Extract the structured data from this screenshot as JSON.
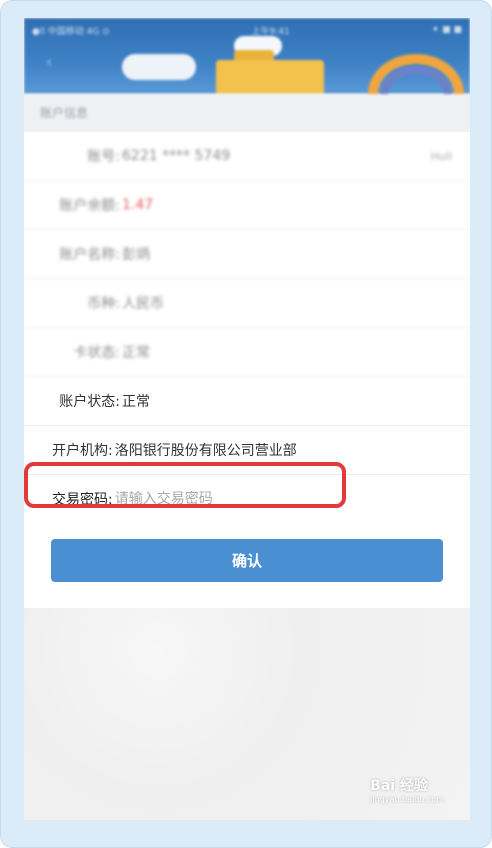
{
  "status_bar": {
    "left": "●ll 中国移动 4G ⊙",
    "center": "上午9:41",
    "right": "✦ ■ ■"
  },
  "section": {
    "title": "账户信息"
  },
  "rows": [
    {
      "label": "账号:",
      "value": "6221 **** 5749",
      "more": "Hull"
    },
    {
      "label": "账户余额:",
      "value": "1.47"
    },
    {
      "label": "账户名称:",
      "value": "彭炳"
    },
    {
      "label": "币种:",
      "value": "人民币"
    },
    {
      "label": "卡状态:",
      "value": "正常"
    },
    {
      "label": "账户状态:",
      "value": "正常"
    },
    {
      "label": "开户机构:",
      "value": "洛阳银行股份有限公司营业部"
    }
  ],
  "password": {
    "label": "交易密码:",
    "placeholder": "请输入交易密码",
    "value": ""
  },
  "confirm_button": {
    "label": "确认"
  },
  "watermark": {
    "text": "Bai 经验",
    "sub": "jingyan.baidu.com"
  },
  "colors": {
    "accent": "#4b8fd3",
    "highlight": "#e2393b",
    "balance": "#e15a5a"
  }
}
